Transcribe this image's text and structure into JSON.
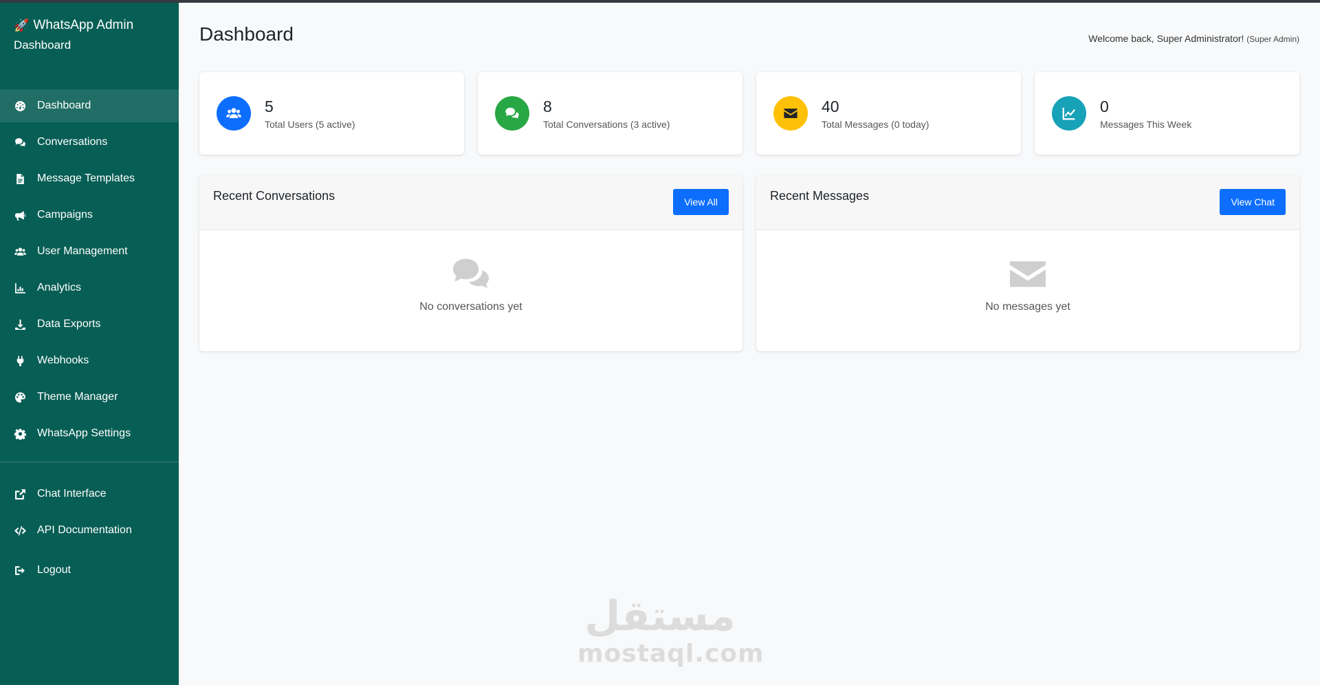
{
  "brand": {
    "icon": "rocket-icon",
    "line1": "WhatsApp Admin",
    "line2": "Dashboard"
  },
  "sidebar": {
    "items": [
      {
        "label": "Dashboard",
        "icon": "palette-dashboard-icon",
        "active": true
      },
      {
        "label": "Conversations",
        "icon": "comments-icon"
      },
      {
        "label": "Message Templates",
        "icon": "file-icon"
      },
      {
        "label": "Campaigns",
        "icon": "megaphone-icon"
      },
      {
        "label": "User Management",
        "icon": "users-icon"
      },
      {
        "label": "Analytics",
        "icon": "chart-icon"
      },
      {
        "label": "Data Exports",
        "icon": "download-icon"
      },
      {
        "label": "Webhooks",
        "icon": "plug-icon"
      },
      {
        "label": "Theme Manager",
        "icon": "palette-icon"
      },
      {
        "label": "WhatsApp Settings",
        "icon": "gear-icon"
      }
    ],
    "secondary": [
      {
        "label": "Chat Interface",
        "icon": "external-link-icon"
      },
      {
        "label": "API Documentation",
        "icon": "code-icon"
      }
    ],
    "logout": {
      "label": "Logout",
      "icon": "sign-out-icon"
    }
  },
  "header": {
    "title": "Dashboard",
    "welcome": "Welcome back, Super Administrator!",
    "role": "(Super Admin)"
  },
  "stats": [
    {
      "value": "5",
      "label": "Total Users (5 active)",
      "color": "#0d6efd",
      "icon": "users-icon"
    },
    {
      "value": "8",
      "label": "Total Conversations (3 active)",
      "color": "#28a745",
      "icon": "comments-icon"
    },
    {
      "value": "40",
      "label": "Total Messages (0 today)",
      "color": "#ffc107",
      "icon": "envelope-icon"
    },
    {
      "value": "0",
      "label": "Messages This Week",
      "color": "#17a2b8",
      "icon": "chart-line-icon"
    }
  ],
  "panels": {
    "conversations": {
      "title": "Recent Conversations",
      "button": "View All",
      "empty": "No conversations yet"
    },
    "messages": {
      "title": "Recent Messages",
      "button": "View Chat",
      "empty": "No messages yet"
    }
  },
  "watermark": {
    "arabic": "مستقل",
    "latin": "mostaql.com"
  }
}
